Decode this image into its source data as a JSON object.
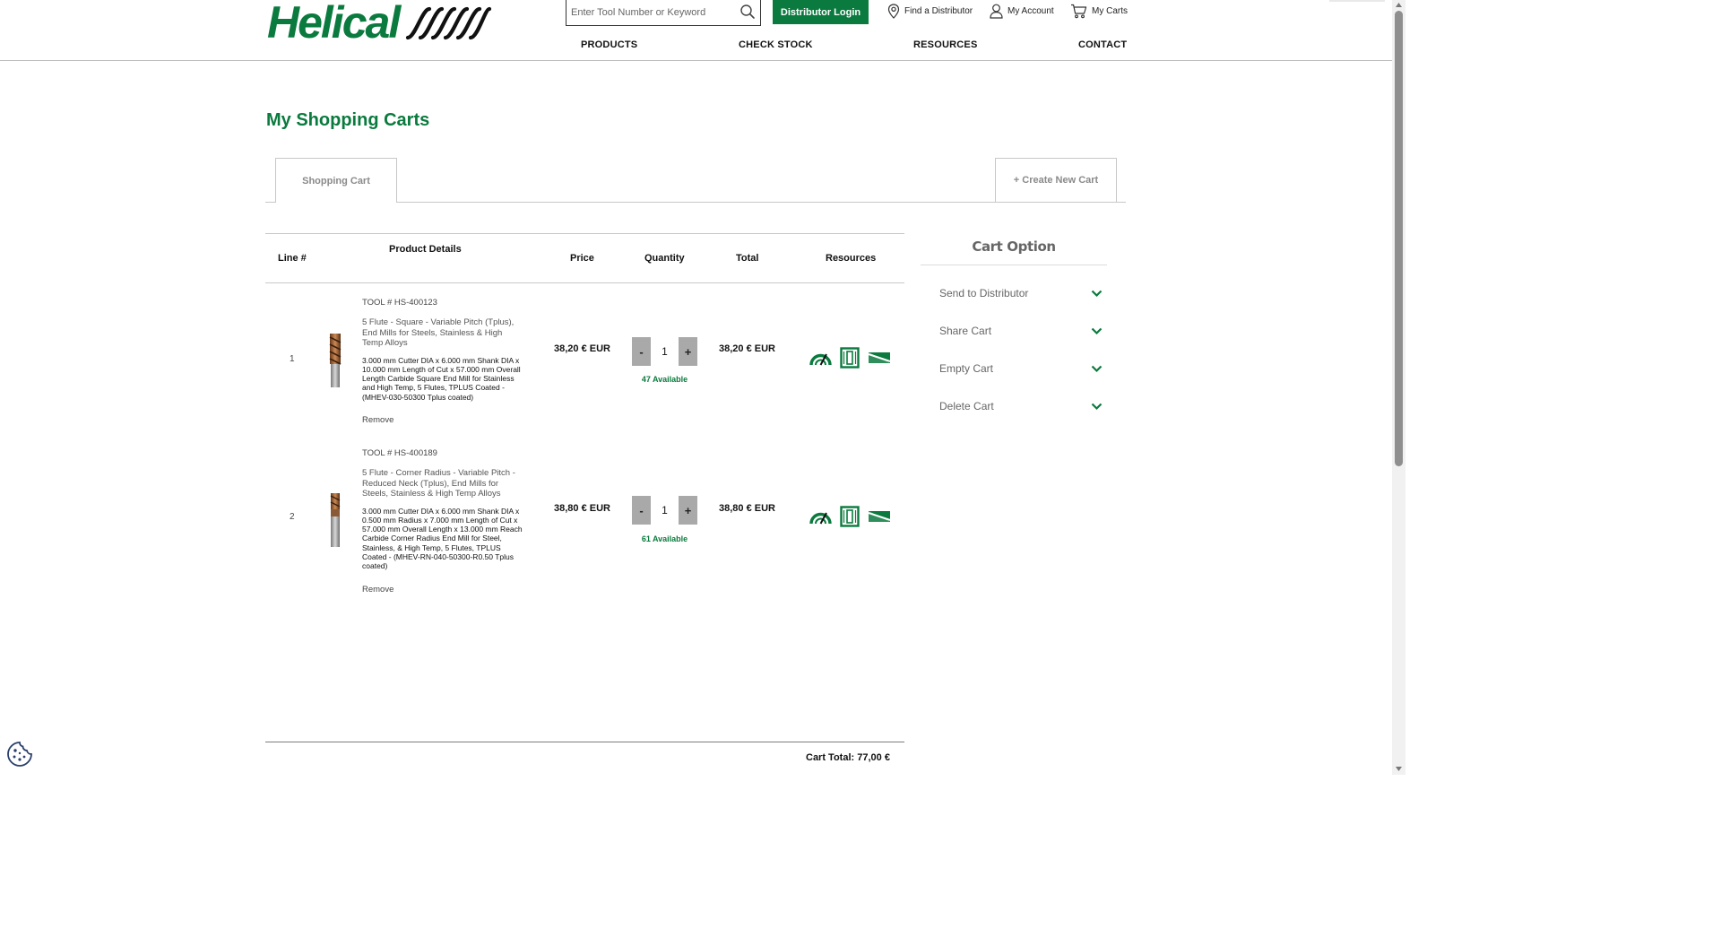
{
  "header": {
    "logo_text": "Helical",
    "search_placeholder": "Enter Tool Number or Keyword",
    "distributor_login": "Distributor Login",
    "find_distributor": "Find a Distributor",
    "my_account": "My Account",
    "my_carts": "My Carts",
    "nav": [
      "PRODUCTS",
      "CHECK STOCK",
      "RESOURCES",
      "CONTACT"
    ]
  },
  "page_title": "My Shopping Carts",
  "tabs": {
    "active": "Shopping Cart",
    "create_new": "+ Create New Cart"
  },
  "table": {
    "columns": [
      "Line #",
      "Product Details",
      "Price",
      "Quantity",
      "Total",
      "Resources"
    ],
    "rows": [
      {
        "line": "1",
        "tool_no": "TOOL # HS-400123",
        "short_desc": "5 Flute - Square - Variable Pitch (Tplus), End Mills for Steels, Stainless & High Temp Alloys",
        "long_desc": "3.000 mm Cutter DIA x 6.000 mm Shank DIA x 10.000 mm Length of Cut x 57.000 mm Overall Length Carbide Square End Mill for Stainless and High Temp, 5 Flutes, TPLUS Coated - (MHEV-030-50300 Tplus coated)",
        "remove": "Remove",
        "price": "38,20 € EUR",
        "qty_minus": "-",
        "qty": "1",
        "qty_plus": "+",
        "available": "47 Available",
        "total": "38,20 € EUR",
        "resources": [
          "speed-gauge-icon",
          "tool-drawing-icon",
          "flute-profile-icon"
        ]
      },
      {
        "line": "2",
        "tool_no": "TOOL # HS-400189",
        "short_desc": "5 Flute - Corner Radius - Variable Pitch - Reduced Neck (Tplus), End Mills for Steels, Stainless & High Temp Alloys",
        "long_desc": "3.000 mm Cutter DIA x 6.000 mm Shank DIA x 0.500 mm Radius x 7.000 mm Length of Cut x 57.000 mm Overall Length x 13.000 mm Reach Carbide Corner Radius End Mill for Steel, Stainless, & High Temp, 5 Flutes, TPLUS Coated - (MHEV-RN-040-50300-R0.50 Tplus coated)",
        "remove": "Remove",
        "price": "38,80 € EUR",
        "qty_minus": "-",
        "qty": "1",
        "qty_plus": "+",
        "available": "61 Available",
        "total": "38,80 € EUR",
        "resources": [
          "speed-gauge-icon",
          "tool-drawing-icon",
          "flute-profile-icon"
        ]
      }
    ],
    "cart_total": "Cart Total: 77,00 €"
  },
  "cart_option": {
    "title": "Cart Option",
    "items": [
      "Send to Distributor",
      "Share Cart",
      "Empty Cart",
      "Delete Cart"
    ]
  },
  "colors": {
    "brand_green": "#0a7a3e",
    "qty_button_gray": "#a9a9a9",
    "option_text_gray": "#666666"
  }
}
